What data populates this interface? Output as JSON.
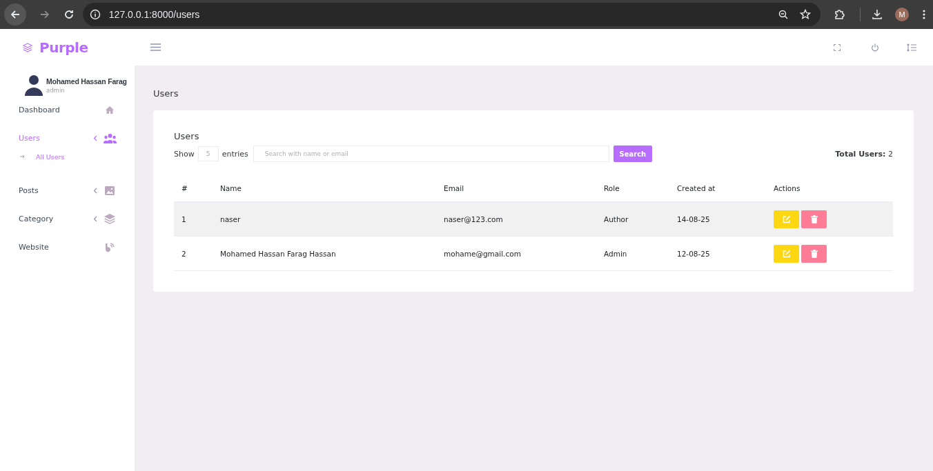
{
  "browser": {
    "url": "127.0.0.1:8000/users",
    "profile_initial": "M"
  },
  "brand": {
    "name": "Purple"
  },
  "profile": {
    "name": "Mohamed Hassan Farag",
    "role": "admin"
  },
  "sidebar": {
    "items": [
      {
        "label": "Dashboard",
        "selected": false,
        "expandable": false
      },
      {
        "label": "Users",
        "selected": true,
        "expandable": true,
        "children": [
          {
            "label": "All Users"
          }
        ]
      },
      {
        "label": "Posts",
        "selected": false,
        "expandable": true
      },
      {
        "label": "Category",
        "selected": false,
        "expandable": true
      },
      {
        "label": "Website",
        "selected": false,
        "expandable": false
      }
    ]
  },
  "page_title": "Users",
  "card": {
    "title": "Users",
    "show_label": "Show",
    "entries_value": "5",
    "entries_label": "entries",
    "search": {
      "placeholder": "Search with name or email"
    },
    "search_button": "Search",
    "total_label": "Total Users:",
    "total_value": "2"
  },
  "table": {
    "columns": [
      "#",
      "Name",
      "Email",
      "Role",
      "Created at",
      "Actions"
    ],
    "rows": [
      {
        "cells": [
          "1",
          "naser",
          "naser@123.com",
          "Author",
          "14-08-25"
        ],
        "highlighted": true
      },
      {
        "cells": [
          "2",
          "Mohamed Hassan Farag Hassan",
          "mohame@gmail.com",
          "Admin",
          "12-08-25"
        ],
        "highlighted": false
      }
    ]
  }
}
